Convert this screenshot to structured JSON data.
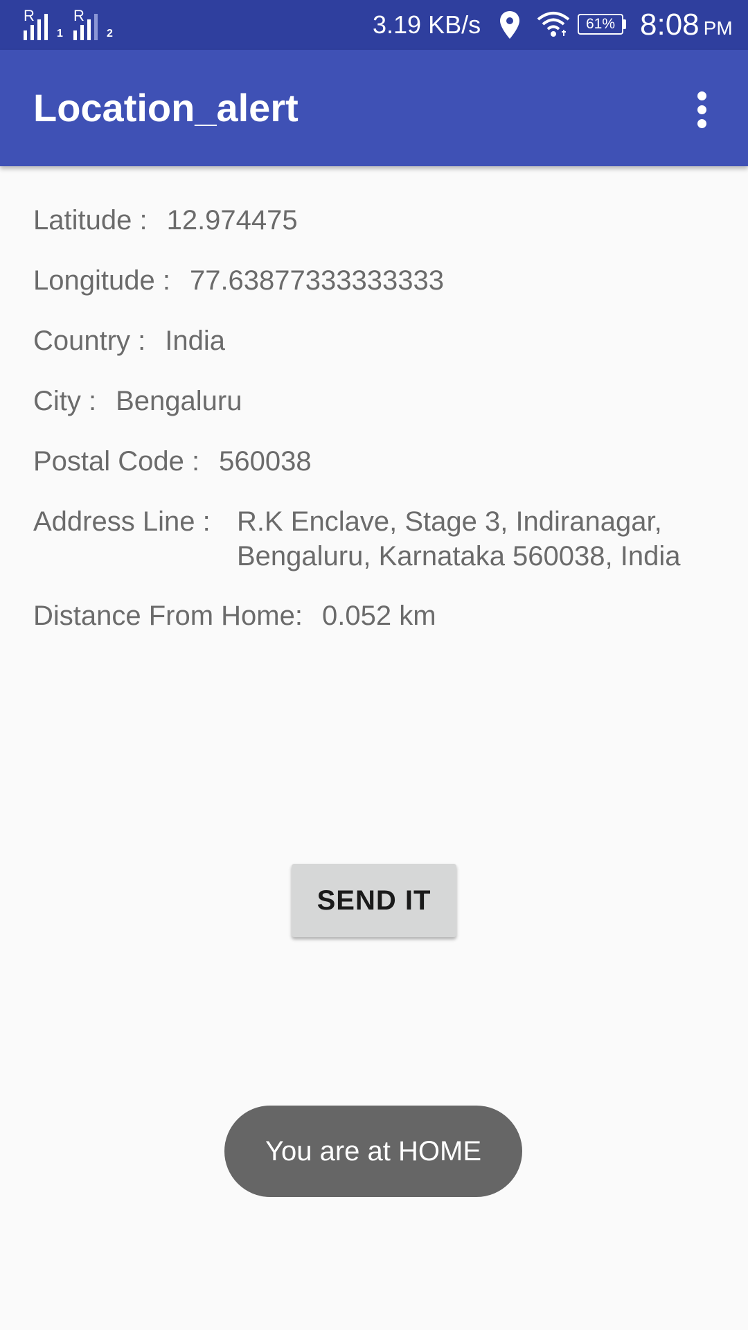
{
  "status_bar": {
    "sim1_label": "1",
    "sim2_label": "2",
    "network_speed": "3.19 KB/s",
    "battery": "61%",
    "time": "8:08",
    "ampm": "PM",
    "icons": [
      "signal-icon",
      "location-icon",
      "wifi-icon",
      "battery-icon"
    ]
  },
  "app_bar": {
    "title": "Location_alert",
    "color": "#3f51b5",
    "overflow_icon": "more-vert-icon"
  },
  "location": {
    "latitude_label": "Latitude :",
    "latitude_value": "12.974475",
    "longitude_label": "Longitude :",
    "longitude_value": "77.63877333333333",
    "country_label": "Country :",
    "country_value": "India",
    "city_label": "City :",
    "city_value": "Bengaluru",
    "postal_label": "Postal Code :",
    "postal_value": "560038",
    "address_label": "Address Line :",
    "address_value": "R.K Enclave, Stage 3, Indiranagar, Bengaluru, Karnataka 560038, India",
    "distance_label": "Distance From Home:",
    "distance_value": "0.052 km"
  },
  "send_button": {
    "label": "SEND IT"
  },
  "toast": {
    "message": "You are at HOME"
  }
}
